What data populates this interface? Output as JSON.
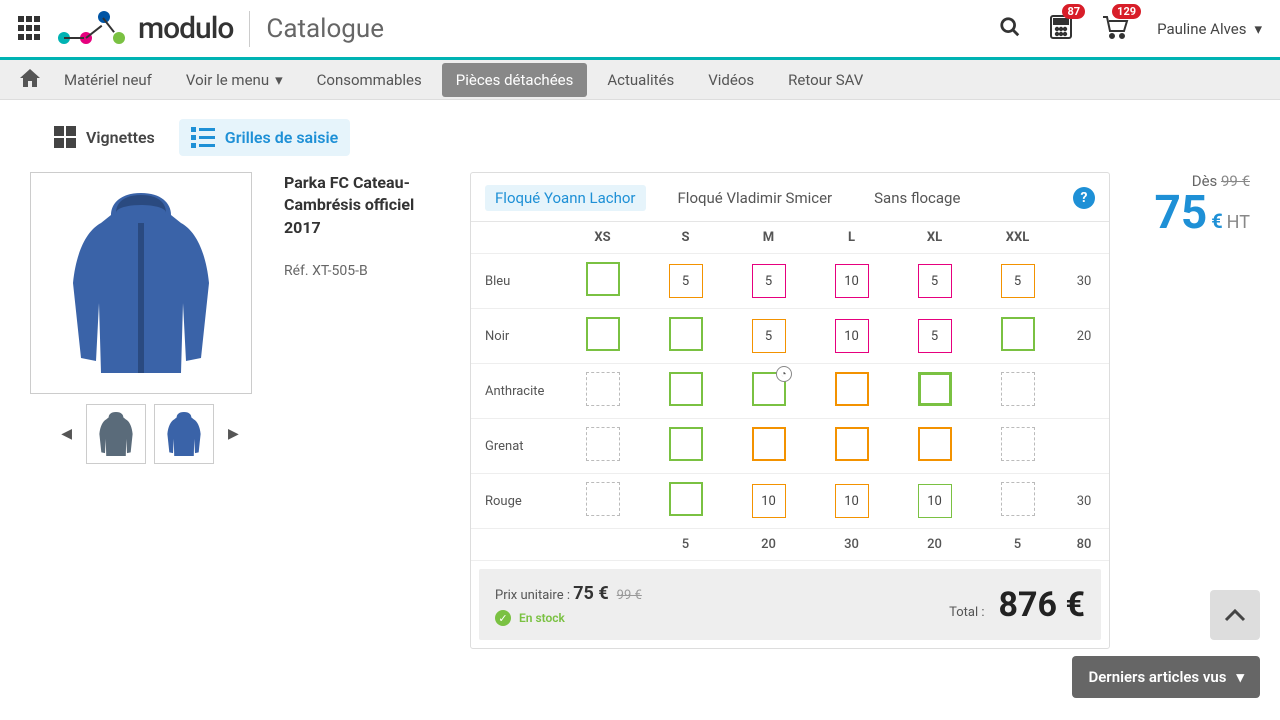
{
  "header": {
    "catalogue_title": "Catalogue",
    "calc_badge": "87",
    "cart_badge": "129",
    "user": "Pauline Alves"
  },
  "nav": {
    "items": [
      "Matériel neuf",
      "Voir le menu",
      "Consommables",
      "Pièces détachées",
      "Actualités",
      "Vidéos",
      "Retour SAV"
    ],
    "active_index": 3,
    "has_submenu_index": 1
  },
  "viewswitch": {
    "thumbnails_label": "Vignettes",
    "grid_label": "Grilles de saisie"
  },
  "product": {
    "title": "Parka FC Cateau-Cambrésis officiel 2017",
    "ref_prefix": "Réf. ",
    "ref": "XT-505-B"
  },
  "price": {
    "from": "Dès ",
    "old": "99 €",
    "value": "75",
    "currency": "€",
    "suffix": " HT"
  },
  "tabs": {
    "items": [
      "Floqué Yoann Lachor",
      "Floqué Vladimir Smicer",
      "Sans flocage"
    ],
    "active_index": 0
  },
  "grid": {
    "size_headers": [
      "XS",
      "S",
      "M",
      "L",
      "XL",
      "XXL"
    ],
    "rows": [
      {
        "label": "Bleu",
        "total": "30",
        "cells": [
          {
            "val": "",
            "style": "green",
            "w": 2
          },
          {
            "val": "5",
            "style": "orange",
            "w": 1
          },
          {
            "val": "5",
            "style": "red",
            "w": 1
          },
          {
            "val": "10",
            "style": "red",
            "w": 1
          },
          {
            "val": "5",
            "style": "red",
            "w": 1
          },
          {
            "val": "5",
            "style": "orange",
            "w": 1
          }
        ]
      },
      {
        "label": "Noir",
        "total": "20",
        "cells": [
          {
            "val": "",
            "style": "green",
            "w": 2
          },
          {
            "val": "",
            "style": "green",
            "w": 2
          },
          {
            "val": "5",
            "style": "orange",
            "w": 1
          },
          {
            "val": "10",
            "style": "red",
            "w": 1
          },
          {
            "val": "5",
            "style": "red",
            "w": 1
          },
          {
            "val": "",
            "style": "green",
            "w": 2
          }
        ]
      },
      {
        "label": "Anthracite",
        "total": "",
        "cells": [
          {
            "val": "",
            "style": "dash",
            "w": 1
          },
          {
            "val": "",
            "style": "green",
            "w": 2
          },
          {
            "val": "",
            "style": "green",
            "w": 2,
            "clock": true
          },
          {
            "val": "",
            "style": "orange",
            "w": 2
          },
          {
            "val": "",
            "style": "green",
            "w": 3
          },
          {
            "val": "",
            "style": "dash",
            "w": 1
          }
        ]
      },
      {
        "label": "Grenat",
        "total": "",
        "cells": [
          {
            "val": "",
            "style": "dash",
            "w": 1
          },
          {
            "val": "",
            "style": "green",
            "w": 2
          },
          {
            "val": "",
            "style": "orange",
            "w": 2
          },
          {
            "val": "",
            "style": "orange",
            "w": 2
          },
          {
            "val": "",
            "style": "orange",
            "w": 2
          },
          {
            "val": "",
            "style": "dash",
            "w": 1
          }
        ]
      },
      {
        "label": "Rouge",
        "total": "30",
        "cells": [
          {
            "val": "",
            "style": "dash",
            "w": 1
          },
          {
            "val": "",
            "style": "green",
            "w": 2
          },
          {
            "val": "10",
            "style": "orange",
            "w": 1
          },
          {
            "val": "10",
            "style": "orange",
            "w": 1
          },
          {
            "val": "10",
            "style": "green",
            "w": 1
          },
          {
            "val": "",
            "style": "dash",
            "w": 1
          }
        ]
      }
    ],
    "col_totals": [
      "",
      "5",
      "20",
      "30",
      "20",
      "5"
    ],
    "grand_total": "80"
  },
  "footer": {
    "unit_label": "Prix unitaire : ",
    "unit_price": "75 €",
    "unit_old": "99 €",
    "stock_label": "En stock",
    "total_label": "Total :",
    "total_value": "876 €"
  },
  "scroll_arrow": "︿",
  "recent_label": "Derniers articles vus"
}
